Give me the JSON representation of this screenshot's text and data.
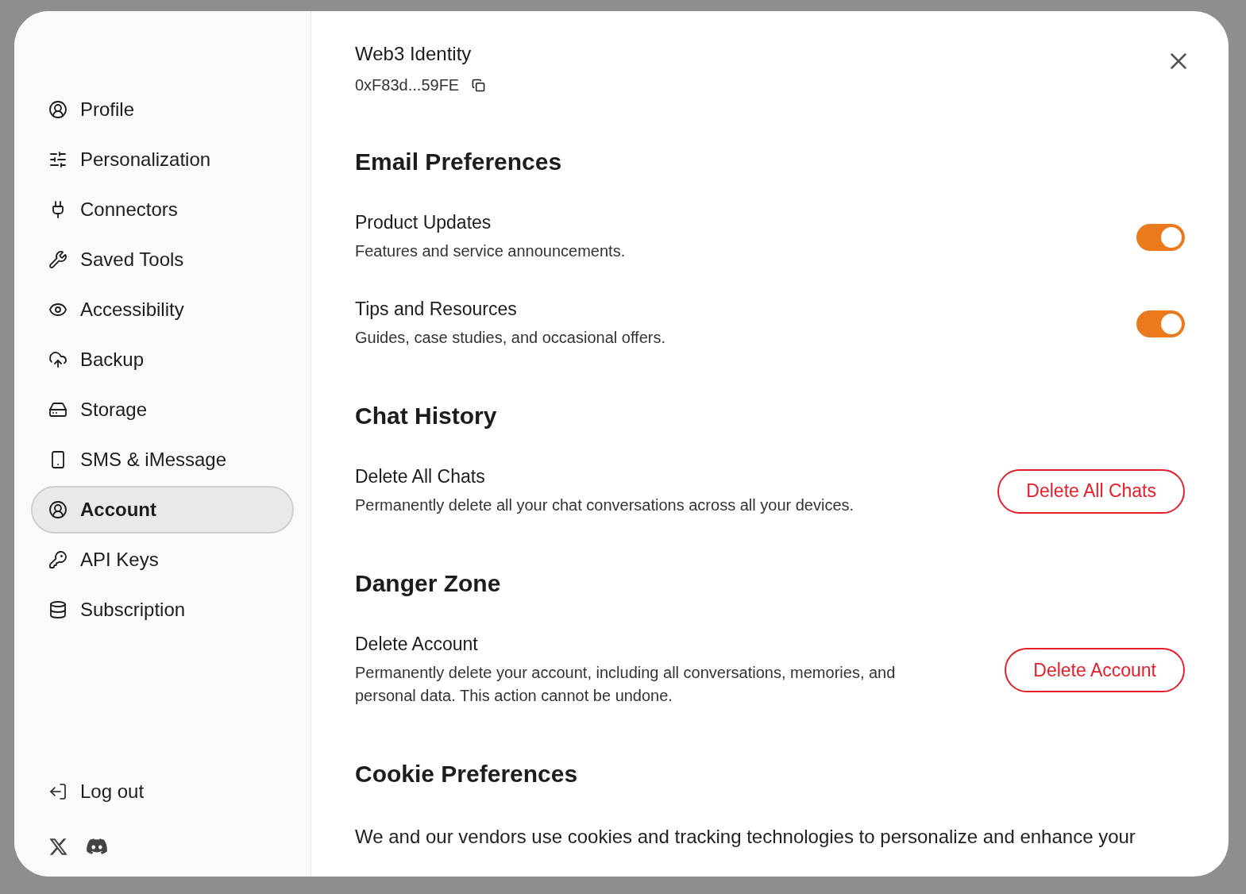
{
  "sidebar": {
    "items": [
      {
        "label": "Profile",
        "selected": false
      },
      {
        "label": "Personalization",
        "selected": false
      },
      {
        "label": "Connectors",
        "selected": false
      },
      {
        "label": "Saved Tools",
        "selected": false
      },
      {
        "label": "Accessibility",
        "selected": false
      },
      {
        "label": "Backup",
        "selected": false
      },
      {
        "label": "Storage",
        "selected": false
      },
      {
        "label": "SMS & iMessage",
        "selected": false
      },
      {
        "label": "Account",
        "selected": true
      },
      {
        "label": "API Keys",
        "selected": false
      },
      {
        "label": "Subscription",
        "selected": false
      }
    ],
    "logout": "Log out"
  },
  "identity": {
    "title": "Web3 Identity",
    "address": "0xF83d...59FE"
  },
  "sections": [
    {
      "kind": "toggles",
      "heading": "Email Preferences",
      "items": [
        {
          "title": "Product Updates",
          "description": "Features and service announcements.",
          "on": true
        },
        {
          "title": "Tips and Resources",
          "description": "Guides, case studies, and occasional offers.",
          "on": true
        }
      ]
    },
    {
      "kind": "actions",
      "heading": "Chat History",
      "items": [
        {
          "title": "Delete All Chats",
          "description": "Permanently delete all your chat conversations across all your devices.",
          "button": "Delete All Chats"
        }
      ]
    },
    {
      "kind": "actions",
      "heading": "Danger Zone",
      "items": [
        {
          "title": "Delete Account",
          "description": "Permanently delete your account, including all conversations, memories, and personal data. This action cannot be undone.",
          "button": "Delete Account"
        }
      ]
    },
    {
      "kind": "text",
      "heading": "Cookie Preferences",
      "text": "We and our vendors use cookies and tracking technologies to personalize and enhance your"
    }
  ]
}
